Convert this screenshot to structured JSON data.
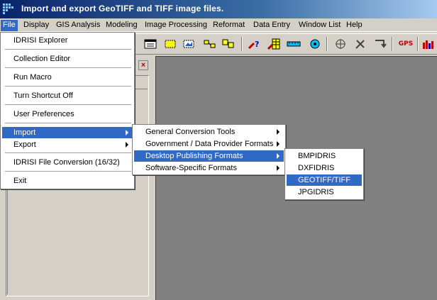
{
  "window": {
    "title": "Import and export GeoTIFF and TIFF image files."
  },
  "menubar": {
    "items": [
      "File",
      "Display",
      "GIS Analysis",
      "Modeling",
      "Image Processing",
      "Reformat",
      "Data Entry",
      "Window List",
      "Help"
    ],
    "active": "File"
  },
  "file_menu": {
    "items": [
      "IDRISI Explorer",
      "Collection Editor",
      "Run Macro",
      "Turn Shortcut Off",
      "User Preferences",
      "Import",
      "Export",
      "IDRISI File Conversion (16/32)",
      "Exit"
    ],
    "highlighted": "Import"
  },
  "import_menu": {
    "items": [
      "General Conversion Tools",
      "Government / Data Provider Formats",
      "Desktop Publishing Formats",
      "Software-Specific Formats"
    ],
    "highlighted": "Desktop Publishing Formats"
  },
  "desktop_menu": {
    "items": [
      "BMPIDRIS",
      "DXFIDRIS",
      "GEOTIFF/TIFF",
      "JPGIDRIS"
    ],
    "highlighted": "GEOTIFF/TIFF"
  },
  "toolbar": {
    "gps_label": "GPS"
  },
  "panel": {
    "close_glyph": "×"
  },
  "colors": {
    "highlight": "#316ac5",
    "workspace": "#808080",
    "face": "#d4d0c8"
  }
}
